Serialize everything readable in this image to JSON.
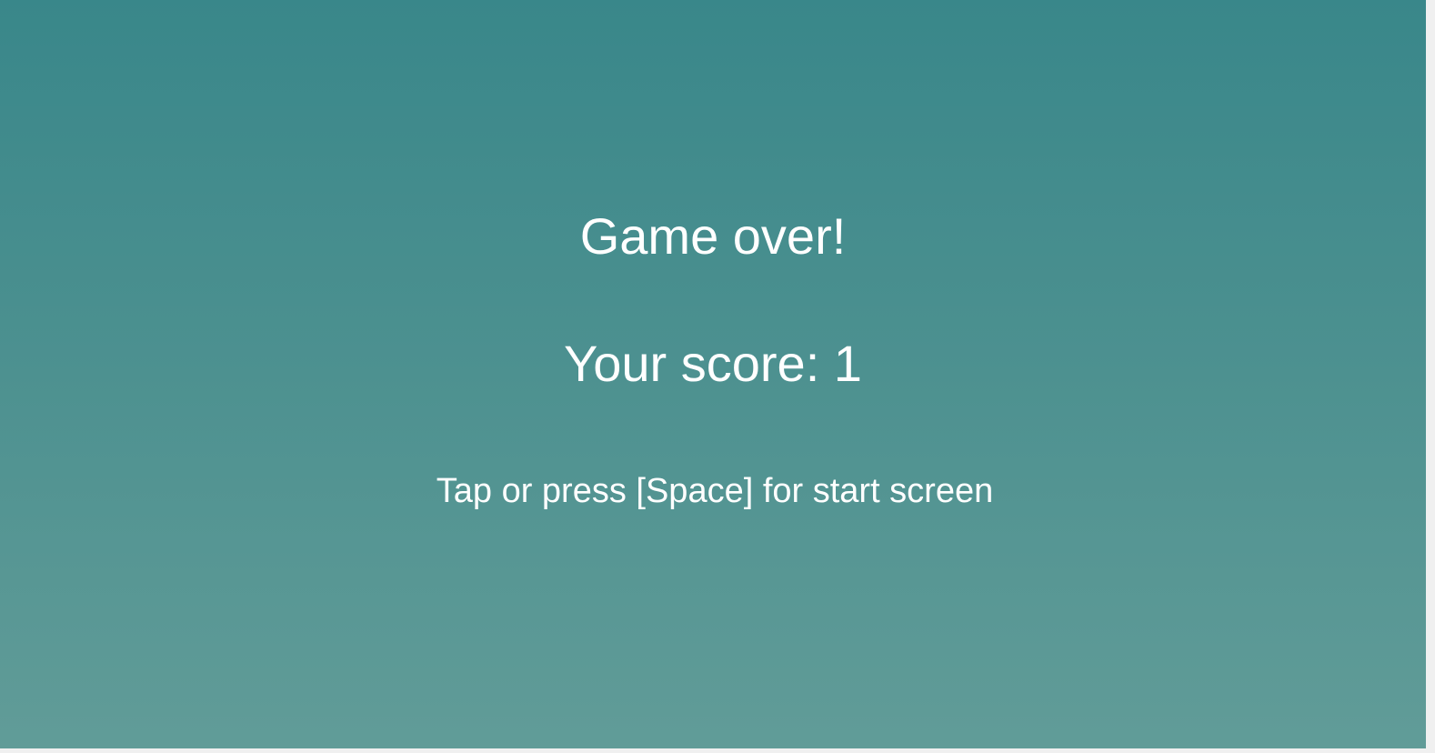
{
  "game": {
    "title": "Game over!",
    "score_text": "Your score: 1",
    "hint": "Tap or press [Space] for start screen"
  },
  "colors": {
    "background_top": "#39878a",
    "background_bottom": "#619c98",
    "text": "#ffffff"
  }
}
